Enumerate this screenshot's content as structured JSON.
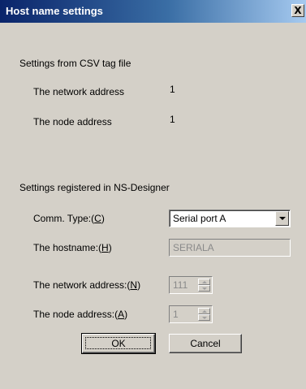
{
  "dialog": {
    "title": "Host name settings",
    "close_glyph": "X"
  },
  "csv_section": {
    "heading": "Settings from CSV tag file",
    "network_address_label": "The network address",
    "network_address_value": "1",
    "node_address_label": "The node address",
    "node_address_value": "1"
  },
  "ns_section": {
    "heading": "Settings registered in NS-Designer",
    "comm_type": {
      "label": "Comm. Type:(",
      "accel": "C",
      "label_end": ")",
      "value": "Serial port A",
      "icon": "chevron-down-icon"
    },
    "hostname": {
      "label": "The hostname:(",
      "accel": "H",
      "label_end": ")",
      "value": "SERIALA"
    },
    "network_address": {
      "label": "The network address:(",
      "accel": "N",
      "label_end": ")",
      "value": "111"
    },
    "node_address": {
      "label": "The node address:(",
      "accel": "A",
      "label_end": ")",
      "value": "1"
    }
  },
  "buttons": {
    "ok": "OK",
    "cancel": "Cancel"
  },
  "colors": {
    "title_bar_start": "#0a246a",
    "title_bar_end": "#a6caf0",
    "dialog_face": "#d4d0c8",
    "disabled_text": "#8a8a8a"
  }
}
